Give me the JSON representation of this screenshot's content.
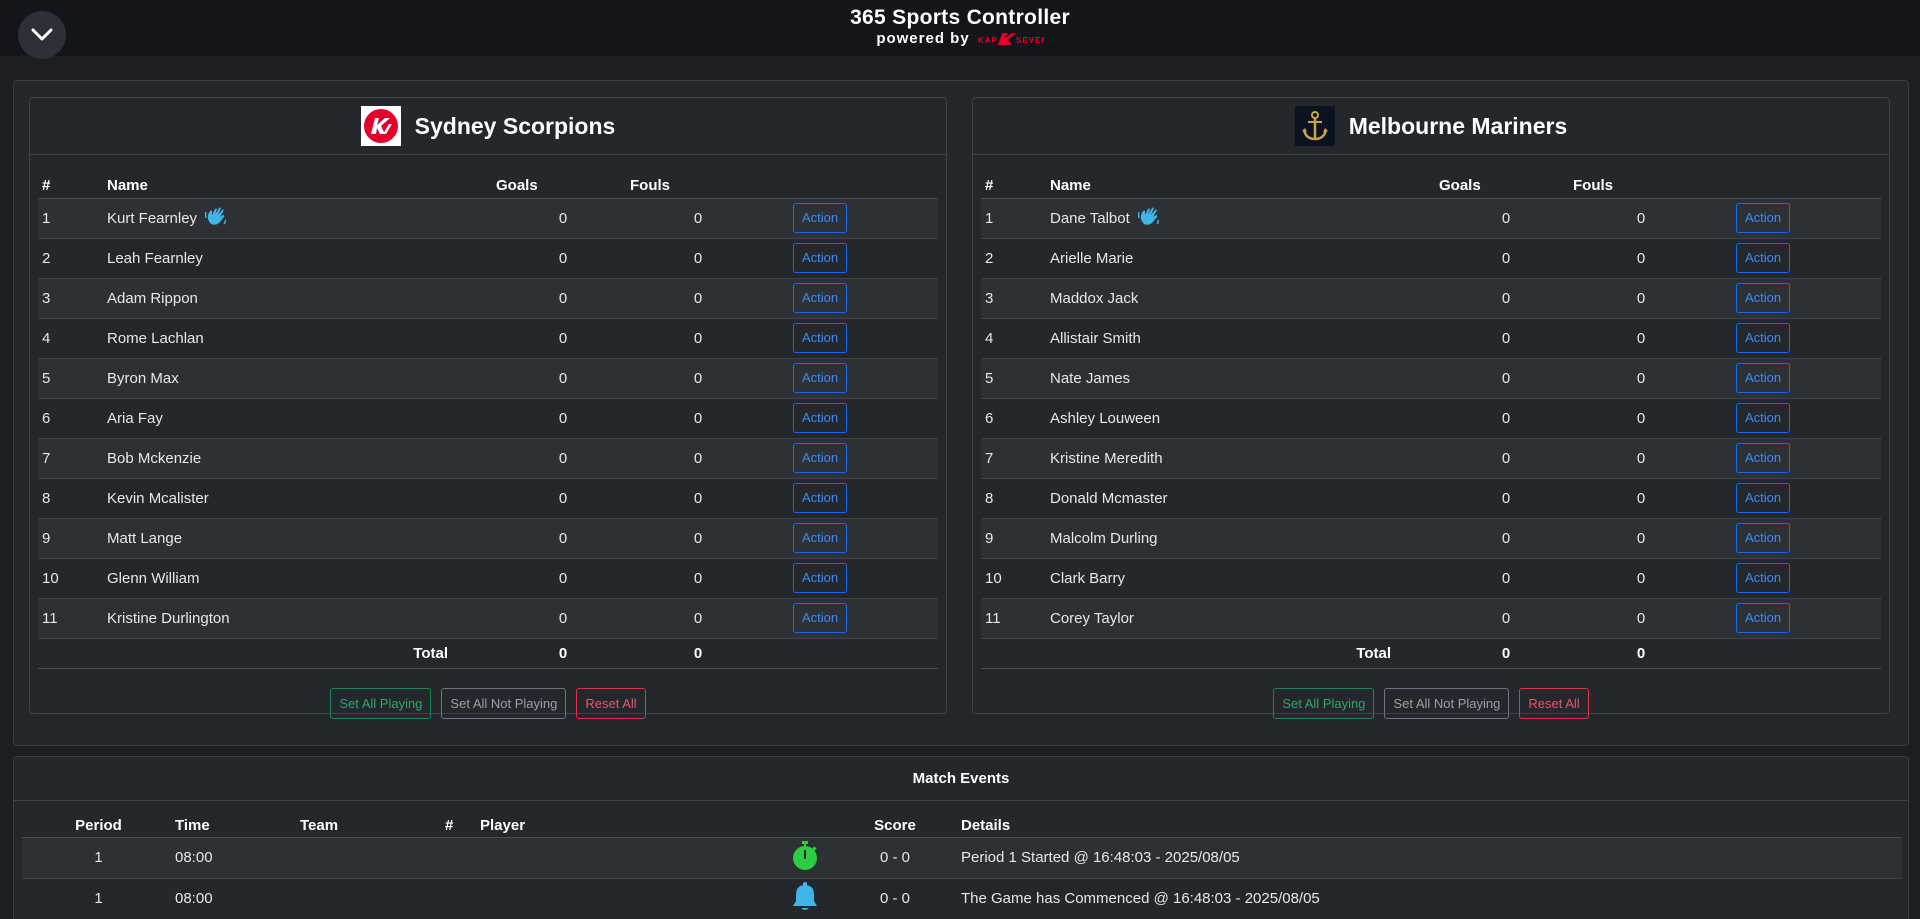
{
  "header": {
    "title": "365 Sports Controller",
    "powered_by": "powered by",
    "logo_text": "KAP SEVEN"
  },
  "colors": {
    "accent_blue": "#0d6efd",
    "green": "#198754",
    "red": "#dc3545",
    "brand_red": "#e4002b"
  },
  "columns": {
    "num": "#",
    "name": "Name",
    "goals": "Goals",
    "fouls": "Fouls"
  },
  "action_label": "Action",
  "total_label": "Total",
  "buttons": {
    "set_all_playing": "Set All Playing",
    "set_all_not_playing": "Set All Not Playing",
    "reset_all": "Reset All"
  },
  "teams": [
    {
      "name": "Sydney Scorpions",
      "logo_icon": "k7-logo",
      "total_goals": "0",
      "total_fouls": "0",
      "players": [
        {
          "num": "1",
          "name": "Kurt Fearnley",
          "goals": "0",
          "fouls": "0",
          "captain": true
        },
        {
          "num": "2",
          "name": "Leah Fearnley",
          "goals": "0",
          "fouls": "0"
        },
        {
          "num": "3",
          "name": "Adam Rippon",
          "goals": "0",
          "fouls": "0"
        },
        {
          "num": "4",
          "name": "Rome Lachlan",
          "goals": "0",
          "fouls": "0"
        },
        {
          "num": "5",
          "name": "Byron Max",
          "goals": "0",
          "fouls": "0"
        },
        {
          "num": "6",
          "name": "Aria Fay",
          "goals": "0",
          "fouls": "0"
        },
        {
          "num": "7",
          "name": "Bob Mckenzie",
          "goals": "0",
          "fouls": "0"
        },
        {
          "num": "8",
          "name": "Kevin Mcalister",
          "goals": "0",
          "fouls": "0"
        },
        {
          "num": "9",
          "name": "Matt Lange",
          "goals": "0",
          "fouls": "0"
        },
        {
          "num": "10",
          "name": "Glenn William",
          "goals": "0",
          "fouls": "0"
        },
        {
          "num": "11",
          "name": "Kristine Durlington",
          "goals": "0",
          "fouls": "0"
        }
      ]
    },
    {
      "name": "Melbourne Mariners",
      "logo_icon": "anchor-logo",
      "total_goals": "0",
      "total_fouls": "0",
      "players": [
        {
          "num": "1",
          "name": "Dane Talbot",
          "goals": "0",
          "fouls": "0",
          "captain": true
        },
        {
          "num": "2",
          "name": "Arielle Marie",
          "goals": "0",
          "fouls": "0"
        },
        {
          "num": "3",
          "name": "Maddox Jack",
          "goals": "0",
          "fouls": "0"
        },
        {
          "num": "4",
          "name": "Allistair Smith",
          "goals": "0",
          "fouls": "0"
        },
        {
          "num": "5",
          "name": "Nate James",
          "goals": "0",
          "fouls": "0"
        },
        {
          "num": "6",
          "name": "Ashley Louween",
          "goals": "0",
          "fouls": "0"
        },
        {
          "num": "7",
          "name": "Kristine Meredith",
          "goals": "0",
          "fouls": "0"
        },
        {
          "num": "8",
          "name": "Donald Mcmaster",
          "goals": "0",
          "fouls": "0"
        },
        {
          "num": "9",
          "name": "Malcolm Durling",
          "goals": "0",
          "fouls": "0"
        },
        {
          "num": "10",
          "name": "Clark Barry",
          "goals": "0",
          "fouls": "0"
        },
        {
          "num": "11",
          "name": "Corey Taylor",
          "goals": "0",
          "fouls": "0"
        }
      ]
    }
  ],
  "events": {
    "title": "Match Events",
    "columns": {
      "period": "Period",
      "time": "Time",
      "team": "Team",
      "num": "#",
      "player": "Player",
      "score": "Score",
      "details": "Details"
    },
    "rows": [
      {
        "period": "1",
        "time": "08:00",
        "team": "",
        "num": "",
        "player": "",
        "icon": "stopwatch-icon",
        "score": "0 - 0",
        "details": "Period 1 Started @ 16:48:03 - 2025/08/05"
      },
      {
        "period": "1",
        "time": "08:00",
        "team": "",
        "num": "",
        "player": "",
        "icon": "bell-icon",
        "score": "0 - 0",
        "details": "The Game has Commenced @ 16:48:03 - 2025/08/05"
      }
    ]
  }
}
